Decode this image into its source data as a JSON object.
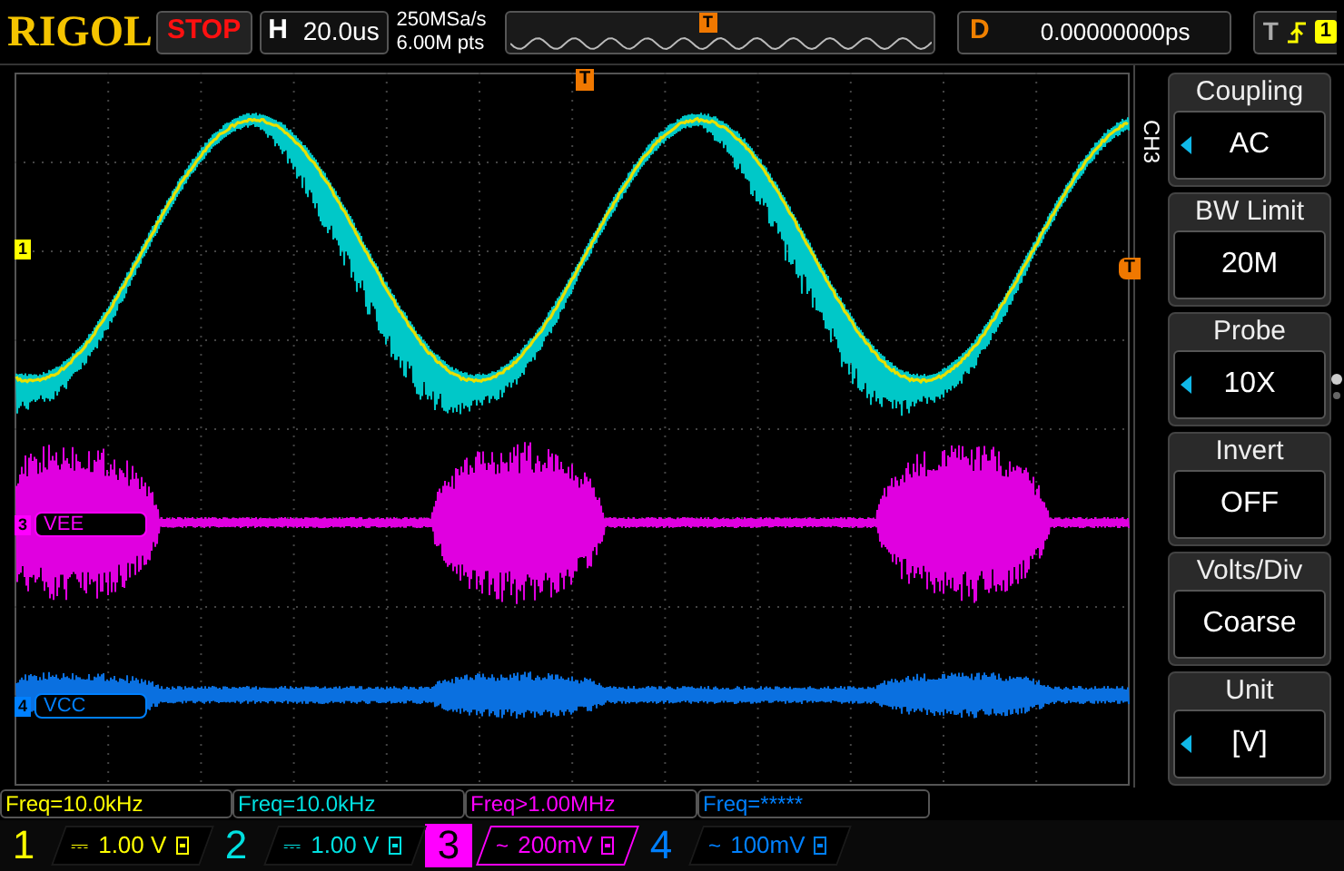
{
  "top_bar": {
    "logo": "RIGOL",
    "run_state": "STOP",
    "horizontal": {
      "label": "H",
      "timebase": "20.0us"
    },
    "sample_rate": "250MSa/s",
    "memory_depth": "6.00M pts",
    "memory_marker": "T",
    "delay": {
      "label": "D",
      "value": "0.00000000ps"
    },
    "trigger": {
      "label": "T",
      "source": "1"
    }
  },
  "display": {
    "trigger_position_marker": "T",
    "trigger_level_marker": "T",
    "channel_markers": [
      {
        "number": "1",
        "color": "#ffff00"
      },
      {
        "number": "3",
        "label": "VEE",
        "color": "#ff00ff"
      },
      {
        "number": "4",
        "label": "VCC",
        "color": "#0080ff"
      }
    ]
  },
  "measurements": [
    {
      "text": "Freq=10.0kHz",
      "color": "#ffff00"
    },
    {
      "text": "Freq=10.0kHz",
      "color": "#00e0e0"
    },
    {
      "text": "Freq>1.00MHz",
      "color": "#ff00ff"
    },
    {
      "text": "Freq=*****",
      "color": "#0080ff"
    }
  ],
  "channels": [
    {
      "number": "1",
      "coupling": "⎓",
      "scale": "1.00 V",
      "color": "#ffff00",
      "selected": false
    },
    {
      "number": "2",
      "coupling": "⎓",
      "scale": "1.00 V",
      "color": "#00e0e0",
      "selected": false
    },
    {
      "number": "3",
      "coupling": "~",
      "scale": "200mV",
      "color": "#ff00ff",
      "selected": true
    },
    {
      "number": "4",
      "coupling": "~",
      "scale": "100mV",
      "color": "#0080ff",
      "selected": false
    }
  ],
  "menu": {
    "channel": "CH3",
    "items": [
      {
        "title": "Coupling",
        "value": "AC",
        "has_options": true
      },
      {
        "title": "BW Limit",
        "value": "20M",
        "has_options": false
      },
      {
        "title": "Probe",
        "value": "10X",
        "has_options": true
      },
      {
        "title": "Invert",
        "value": "OFF",
        "has_options": false
      },
      {
        "title": "Volts/Div",
        "value": "Coarse",
        "has_options": false
      },
      {
        "title": "Unit",
        "value": "[V]",
        "has_options": true
      }
    ]
  }
}
